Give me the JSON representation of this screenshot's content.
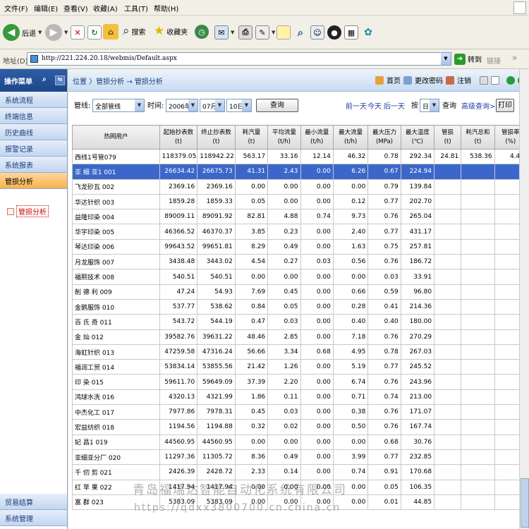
{
  "menu": [
    "文件(F)",
    "编辑(E)",
    "查看(V)",
    "收藏(A)",
    "工具(T)",
    "帮助(H)"
  ],
  "toolbar": {
    "back": "后退",
    "search": "搜索",
    "favorites": "收藏夹"
  },
  "address": {
    "label": "地址(D)",
    "url": "http://221.224.20.18/webmis/Default.aspx",
    "go": "转到",
    "links": "链接"
  },
  "sidebar": {
    "header": "操作菜单",
    "items": [
      "系统流程",
      "终端信息",
      "历史曲线",
      "报警记录",
      "系统报表",
      "管损分析"
    ],
    "sub_item": "管损分析",
    "bottom_items": [
      "贸易结算",
      "系统管理"
    ]
  },
  "crumb": {
    "path": "位置 〉管损分析 → 管损分析",
    "home": "首页",
    "change_pwd": "更改密码",
    "logout": "注销"
  },
  "filter": {
    "pipeline_label": "管线:",
    "pipeline_value": "全部管线",
    "time_label": "时间:",
    "year": "2006年",
    "month": "07月",
    "day": "10日",
    "query_btn": "查询",
    "prev_day": "前一天",
    "today": "今天",
    "next_day": "后一天",
    "by_label": "按",
    "by_value": "日",
    "query2": "查询",
    "advanced": "高级查询>>",
    "print": "打印"
  },
  "table": {
    "headers": [
      [
        "热网用户",
        ""
      ],
      [
        "起始抄表数",
        "(t)"
      ],
      [
        "终止抄表数",
        "(t)"
      ],
      [
        "耗汽量",
        "(t)"
      ],
      [
        "平均流量",
        "(t/h)"
      ],
      [
        "最小流量",
        "(t/h)"
      ],
      [
        "最大流量",
        "(t/h)"
      ],
      [
        "最大压力",
        "(MPa)"
      ],
      [
        "最大温度",
        "(℃)"
      ],
      [
        "管损",
        "(t)"
      ],
      [
        "耗汽总和",
        "(t)"
      ],
      [
        "管损率",
        "(%)"
      ]
    ],
    "rows": [
      [
        "西线1号管079",
        "118379.05",
        "118942.22",
        "563.17",
        "33.16",
        "12.14",
        "46.32",
        "0.78",
        "292.34",
        "24.81",
        "538.36",
        "4.40"
      ],
      [
        "亚 细 亚1 001",
        "26634.42",
        "26675.73",
        "41.31",
        "2.43",
        "0.00",
        "6.26",
        "0.67",
        "224.94",
        "",
        "",
        ""
      ],
      [
        "飞龙砂瓦 002",
        "2369.16",
        "2369.16",
        "0.00",
        "0.00",
        "0.00",
        "0.00",
        "0.79",
        "139.84",
        "",
        "",
        ""
      ],
      [
        "华达针织 003",
        "1859.28",
        "1859.33",
        "0.05",
        "0.00",
        "0.00",
        "0.12",
        "0.77",
        "202.70",
        "",
        "",
        ""
      ],
      [
        "益隆印染 004",
        "89009.11",
        "89091.92",
        "82.81",
        "4.88",
        "0.74",
        "9.73",
        "0.76",
        "265.04",
        "",
        "",
        ""
      ],
      [
        "华宇印染 005",
        "46366.52",
        "46370.37",
        "3.85",
        "0.23",
        "0.00",
        "2.40",
        "0.77",
        "431.17",
        "",
        "",
        ""
      ],
      [
        "琴达印染 006",
        "99643.52",
        "99651.81",
        "8.29",
        "0.49",
        "0.00",
        "1.63",
        "0.75",
        "257.81",
        "",
        "",
        ""
      ],
      [
        "月龙服饰 007",
        "3438.48",
        "3443.02",
        "4.54",
        "0.27",
        "0.03",
        "0.56",
        "0.76",
        "186.72",
        "",
        "",
        ""
      ],
      [
        "福熙技术 008",
        "540.51",
        "540.51",
        "0.00",
        "0.00",
        "0.00",
        "0.00",
        "0.03",
        "33.91",
        "",
        "",
        ""
      ],
      [
        "削 德 利 009",
        "47.24",
        "54.93",
        "7.69",
        "0.45",
        "0.00",
        "0.66",
        "0.59",
        "96.80",
        "",
        "",
        ""
      ],
      [
        "金鹅服饰 010",
        "537.77",
        "538.62",
        "0.84",
        "0.05",
        "0.00",
        "0.28",
        "0.41",
        "214.36",
        "",
        "",
        ""
      ],
      [
        "百 氏 奇 011",
        "543.72",
        "544.19",
        "0.47",
        "0.03",
        "0.00",
        "0.40",
        "0.40",
        "180.00",
        "",
        "",
        ""
      ],
      [
        "金 灿 012",
        "39582.76",
        "39631.22",
        "48.46",
        "2.85",
        "0.00",
        "7.18",
        "0.76",
        "270.29",
        "",
        "",
        ""
      ],
      [
        "海虹针织 013",
        "47259.58",
        "47316.24",
        "56.66",
        "3.34",
        "0.68",
        "4.95",
        "0.78",
        "267.03",
        "",
        "",
        ""
      ],
      [
        "福润工贸 014",
        "53834.14",
        "53855.56",
        "21.42",
        "1.26",
        "0.00",
        "5.19",
        "0.77",
        "245.52",
        "",
        "",
        ""
      ],
      [
        "印 染 015",
        "59611.70",
        "59649.09",
        "37.39",
        "2.20",
        "0.00",
        "6.74",
        "0.76",
        "243.96",
        "",
        "",
        ""
      ],
      [
        "鸿球水洗 016",
        "4320.13",
        "4321.99",
        "1.86",
        "0.11",
        "0.00",
        "0.71",
        "0.74",
        "213.00",
        "",
        "",
        ""
      ],
      [
        "中杰化工 017",
        "7977.86",
        "7978.31",
        "0.45",
        "0.03",
        "0.00",
        "0.38",
        "0.76",
        "171.07",
        "",
        "",
        ""
      ],
      [
        "宏益纺织 018",
        "1194.56",
        "1194.88",
        "0.32",
        "0.02",
        "0.00",
        "0.50",
        "0.76",
        "167.74",
        "",
        "",
        ""
      ],
      [
        "妃 昌1 019",
        "44560.95",
        "44560.95",
        "0.00",
        "0.00",
        "0.00",
        "0.00",
        "0.68",
        "30.76",
        "",
        "",
        ""
      ],
      [
        "亚细亚分厂 020",
        "11297.36",
        "11305.72",
        "8.36",
        "0.49",
        "0.00",
        "3.99",
        "0.77",
        "232.85",
        "",
        "",
        ""
      ],
      [
        "千 仞 剪 021",
        "2426.39",
        "2428.72",
        "2.33",
        "0.14",
        "0.00",
        "0.74",
        "0.91",
        "170.68",
        "",
        "",
        ""
      ],
      [
        "红 苹 果 022",
        "1417.94",
        "1417.94",
        "0.00",
        "0.00",
        "0.00",
        "0.00",
        "0.05",
        "106.35",
        "",
        "",
        ""
      ],
      [
        "富 群 023",
        "5383.09",
        "5383.09",
        "0.00",
        "0.00",
        "0.00",
        "0.00",
        "0.01",
        "44.85",
        "",
        "",
        ""
      ]
    ]
  },
  "watermark": {
    "line1": "青岛福瑞达智能自动化系统有限公司",
    "line2": "https://qdxx3800700.cn.china.cn"
  }
}
